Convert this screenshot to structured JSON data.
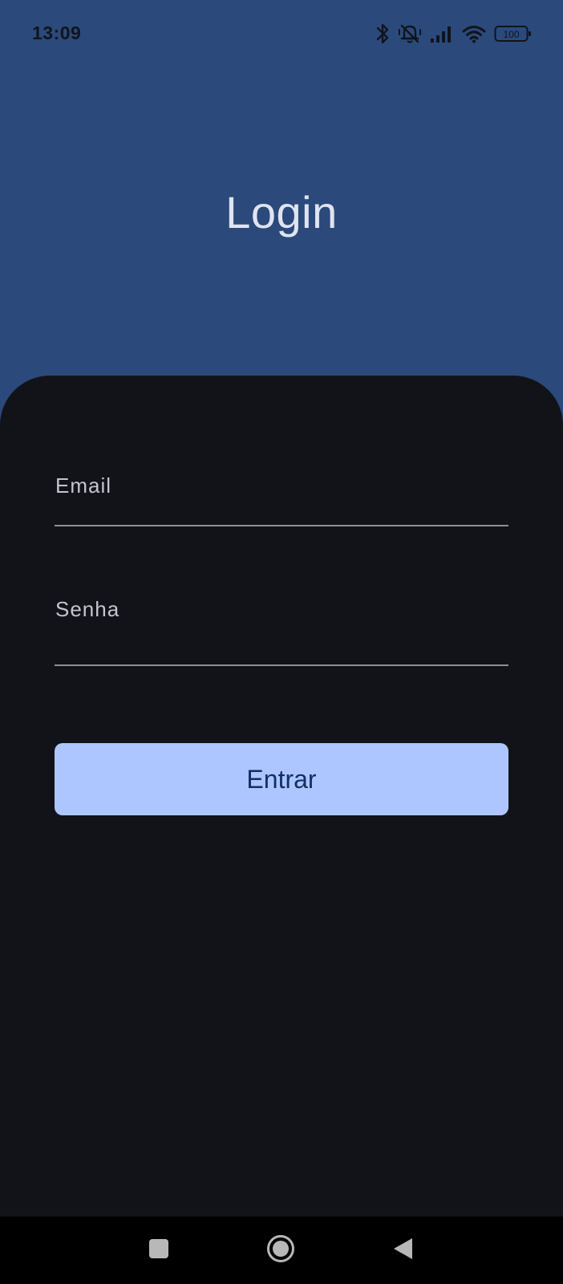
{
  "status_bar": {
    "time": "13:09",
    "battery": "100",
    "icons": [
      "bluetooth-icon",
      "silent-bell-icon",
      "signal-icon",
      "wifi-icon",
      "battery-icon"
    ]
  },
  "header": {
    "title": "Login"
  },
  "form": {
    "email_label": "Email",
    "password_label": "Senha",
    "submit_label": "Entrar"
  },
  "nav_bar": {
    "icons": [
      "recents-icon",
      "home-icon",
      "back-icon"
    ]
  },
  "colors": {
    "header_bg": "#2b4a7b",
    "sheet_bg": "#121318",
    "button_bg": "#adc6ff",
    "button_text": "#123064",
    "title_text": "#dfe4f1",
    "label_text": "#c3c6cf",
    "underline": "#8b8f98"
  }
}
